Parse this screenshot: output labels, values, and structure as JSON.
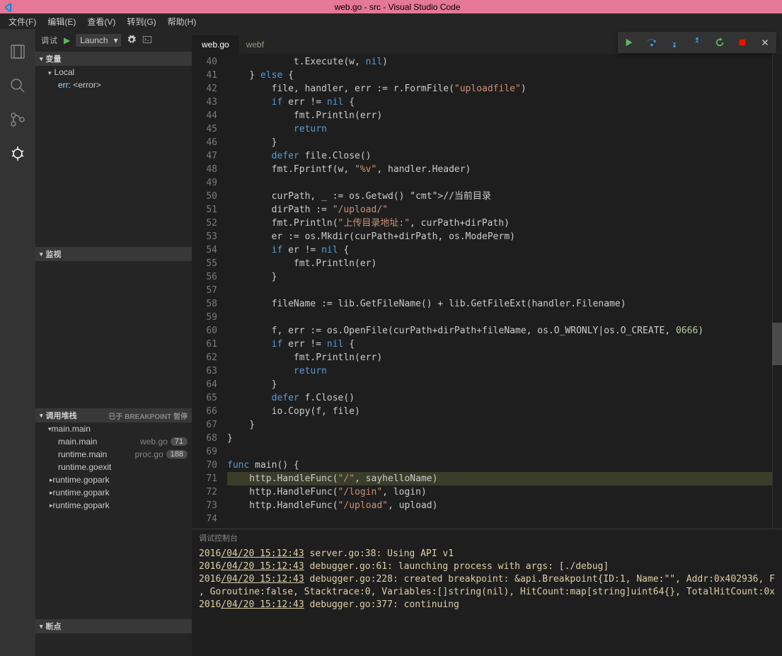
{
  "titlebar": {
    "title": "web.go - src - Visual Studio Code"
  },
  "menu": {
    "file": "文件(F)",
    "edit": "编辑(E)",
    "view": "查看(V)",
    "goto": "转到(G)",
    "help": "帮助(H)"
  },
  "debug": {
    "label": "调试",
    "launch": "Launch"
  },
  "sections": {
    "vars": "变量",
    "local": "Local",
    "var_err_name": "err",
    "var_err_val": ": <error>",
    "watch": "监视",
    "callstack": "调用堆栈",
    "callstack_status": "已于 BREAKPOINT 暂停",
    "breakpoints": "断点"
  },
  "callstack": [
    {
      "name": "main.main",
      "file": "",
      "line": ""
    },
    {
      "name": "main.main",
      "file": "web.go",
      "line": "71"
    },
    {
      "name": "runtime.main",
      "file": "proc.go",
      "line": "188"
    },
    {
      "name": "runtime.goexit",
      "file": "",
      "line": ""
    },
    {
      "name": "runtime.gopark",
      "file": "",
      "line": ""
    },
    {
      "name": "runtime.gopark",
      "file": "",
      "line": ""
    },
    {
      "name": "runtime.gopark",
      "file": "",
      "line": ""
    }
  ],
  "tab": {
    "name": "web.go",
    "companion": "webf"
  },
  "gutter": {
    "start": 40,
    "end": 74,
    "breakpoint": 71
  },
  "code": [
    "            t.Execute(w, nil)",
    "    } else {",
    "        file, handler, err := r.FormFile(\"uploadfile\")",
    "        if err != nil {",
    "            fmt.Println(err)",
    "            return",
    "        }",
    "        defer file.Close()",
    "        fmt.Fprintf(w, \"%v\", handler.Header)",
    "",
    "        curPath, _ := os.Getwd() //当前目录",
    "        dirPath := \"/upload/\"",
    "        fmt.Println(\"上传目录地址:\", curPath+dirPath)",
    "        er := os.Mkdir(curPath+dirPath, os.ModePerm)",
    "        if er != nil {",
    "            fmt.Println(er)",
    "        }",
    "",
    "        fileName := lib.GetFileName() + lib.GetFileExt(handler.Filename)",
    "",
    "        f, err := os.OpenFile(curPath+dirPath+fileName, os.O_WRONLY|os.O_CREATE, 0666)",
    "        if err != nil {",
    "            fmt.Println(err)",
    "            return",
    "        }",
    "        defer f.Close()",
    "        io.Copy(f, file)",
    "    }",
    "}",
    "",
    "func main() {",
    "    http.HandleFunc(\"/\", sayhelloName)",
    "    http.HandleFunc(\"/login\", login)",
    "    http.HandleFunc(\"/upload\", upload)",
    ""
  ],
  "console": {
    "header": "调试控制台",
    "lines": [
      {
        "ts": "2016/04/20 15:12:43",
        "msg": " server.go:38: Using API v1"
      },
      {
        "ts": "2016/04/20 15:12:43",
        "msg": " debugger.go:61: launching process with args: [./debug]"
      },
      {
        "ts": "2016/04/20 15:12:43",
        "msg": " debugger.go:228: created breakpoint: &api.Breakpoint{ID:1, Name:\"\", Addr:0x402936, F"
      },
      {
        "ts": "",
        "msg": ", Goroutine:false, Stacktrace:0, Variables:[]string(nil), HitCount:map[string]uint64{}, TotalHitCount:0x"
      },
      {
        "ts": "2016/04/20 15:12:43",
        "msg": " debugger.go:377: continuing"
      }
    ]
  }
}
